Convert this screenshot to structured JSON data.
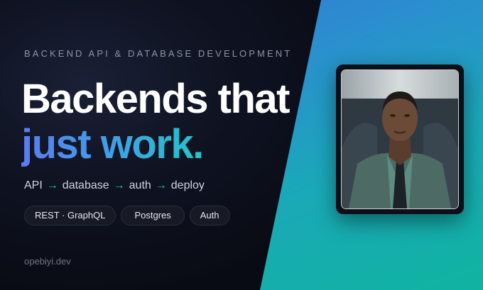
{
  "kicker": "BACKEND API & DATABASE DEVELOPMENT",
  "headline": {
    "line1": "Backends that",
    "line2": "just work."
  },
  "pipeline": {
    "steps": [
      "API",
      "database",
      "auth",
      "deploy"
    ],
    "arrow": "→"
  },
  "chips": [
    "REST · GraphQL",
    "Postgres",
    "Auth"
  ],
  "domain": "opebiyi.dev",
  "photo": {
    "icon": "portrait-photo"
  },
  "colors": {
    "accent_gradient_start": "#5a7cf0",
    "accent_gradient_end": "#22c5c8",
    "arrow": "#2ec4a8",
    "panel_top": "#3b6fd3",
    "panel_bottom": "#10b3a0"
  }
}
